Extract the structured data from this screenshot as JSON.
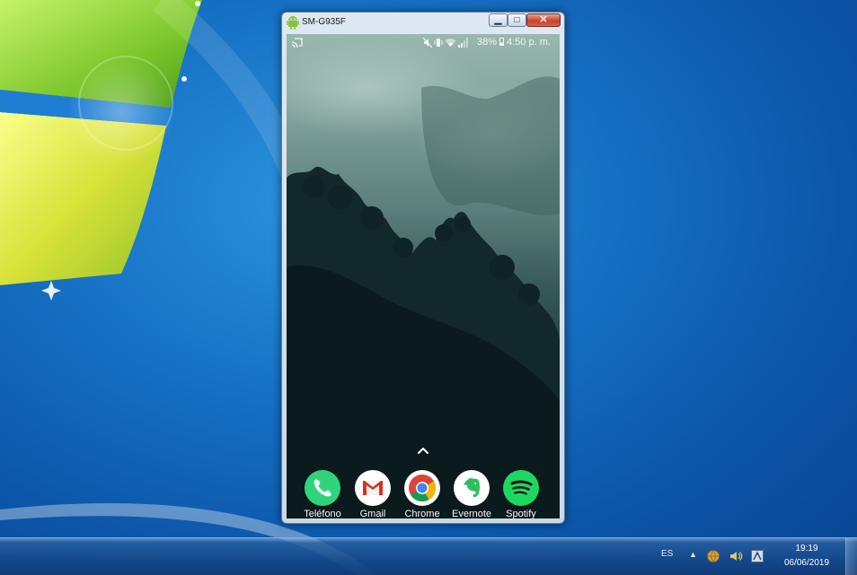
{
  "window": {
    "title": "SM-G935F",
    "icon": "android-icon",
    "controls": {
      "minimize": "minimize-icon",
      "maximize": "maximize-icon",
      "close": "close-icon"
    }
  },
  "phone": {
    "status_bar": {
      "left_icon": "cast-icon",
      "icons": [
        "mute-icon",
        "vibrate-icon",
        "wifi-icon",
        "signal-icon"
      ],
      "battery": "38%",
      "battery_icon": "battery-icon",
      "clock": "4:50 p. m."
    },
    "app_drawer_hint": "up-chevron-icon",
    "dock": [
      {
        "label": "Teléfono",
        "icon": "phone-icon",
        "color": "#2fd47a"
      },
      {
        "label": "Gmail",
        "icon": "gmail-icon",
        "color": "#ffffff"
      },
      {
        "label": "Chrome",
        "icon": "chrome-icon",
        "color": "#ffffff"
      },
      {
        "label": "Evernote",
        "icon": "evernote-icon",
        "color": "#ffffff"
      },
      {
        "label": "Spotify",
        "icon": "spotify-icon",
        "color": "#1ed760"
      }
    ]
  },
  "taskbar": {
    "language": "ES",
    "tray_icons": [
      "show-hidden-icons-arrow",
      "network-icon",
      "volume-icon",
      "tray-app-icon"
    ],
    "time": "19:19",
    "date": "06/06/2019"
  }
}
